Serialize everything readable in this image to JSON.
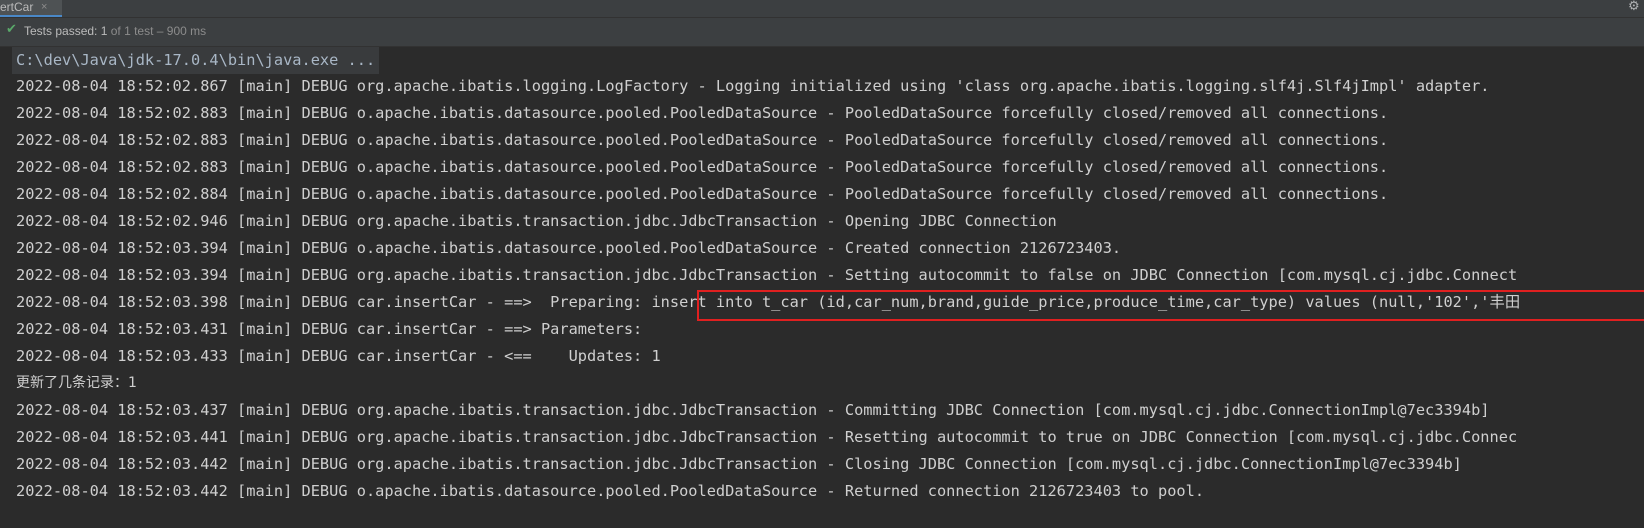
{
  "tab": {
    "title": "ertCar",
    "close_glyph": "×"
  },
  "toolbar": {
    "settings_icon": "gear-icon",
    "settings_glyph": "⚙"
  },
  "status": {
    "icon": "check-icon",
    "icon_glyph": "✔",
    "label": "Tests passed: ",
    "count": "1",
    "detail": " of 1 test – 900 ms"
  },
  "console": {
    "command": "C:\\dev\\Java\\jdk-17.0.4\\bin\\java.exe ...",
    "lines": [
      "2022-08-04 18:52:02.867 [main] DEBUG org.apache.ibatis.logging.LogFactory - Logging initialized using 'class org.apache.ibatis.logging.slf4j.Slf4jImpl' adapter.",
      "2022-08-04 18:52:02.883 [main] DEBUG o.apache.ibatis.datasource.pooled.PooledDataSource - PooledDataSource forcefully closed/removed all connections.",
      "2022-08-04 18:52:02.883 [main] DEBUG o.apache.ibatis.datasource.pooled.PooledDataSource - PooledDataSource forcefully closed/removed all connections.",
      "2022-08-04 18:52:02.883 [main] DEBUG o.apache.ibatis.datasource.pooled.PooledDataSource - PooledDataSource forcefully closed/removed all connections.",
      "2022-08-04 18:52:02.884 [main] DEBUG o.apache.ibatis.datasource.pooled.PooledDataSource - PooledDataSource forcefully closed/removed all connections.",
      "2022-08-04 18:52:02.946 [main] DEBUG org.apache.ibatis.transaction.jdbc.JdbcTransaction - Opening JDBC Connection",
      "2022-08-04 18:52:03.394 [main] DEBUG o.apache.ibatis.datasource.pooled.PooledDataSource - Created connection 2126723403.",
      "2022-08-04 18:52:03.394 [main] DEBUG org.apache.ibatis.transaction.jdbc.JdbcTransaction - Setting autocommit to false on JDBC Connection [com.mysql.cj.jdbc.Connect",
      "2022-08-04 18:52:03.398 [main] DEBUG car.insertCar - ==>  Preparing: insert into t_car (id,car_num,brand,guide_price,produce_time,car_type) values (null,'102','丰田",
      "2022-08-04 18:52:03.431 [main] DEBUG car.insertCar - ==> Parameters: ",
      "2022-08-04 18:52:03.433 [main] DEBUG car.insertCar - <==    Updates: 1",
      "更新了几条记录：1",
      "2022-08-04 18:52:03.437 [main] DEBUG org.apache.ibatis.transaction.jdbc.JdbcTransaction - Committing JDBC Connection [com.mysql.cj.jdbc.ConnectionImpl@7ec3394b]",
      "2022-08-04 18:52:03.441 [main] DEBUG org.apache.ibatis.transaction.jdbc.JdbcTransaction - Resetting autocommit to true on JDBC Connection [com.mysql.cj.jdbc.Connec",
      "2022-08-04 18:52:03.442 [main] DEBUG org.apache.ibatis.transaction.jdbc.JdbcTransaction - Closing JDBC Connection [com.mysql.cj.jdbc.ConnectionImpl@7ec3394b]",
      "2022-08-04 18:52:03.442 [main] DEBUG o.apache.ibatis.datasource.pooled.PooledDataSource - Returned connection 2126723403 to pool."
    ]
  },
  "colors": {
    "background": "#2b2b2b",
    "text": "#cfcfcf",
    "pass_green": "#59a869",
    "highlight_red": "#e02020"
  }
}
